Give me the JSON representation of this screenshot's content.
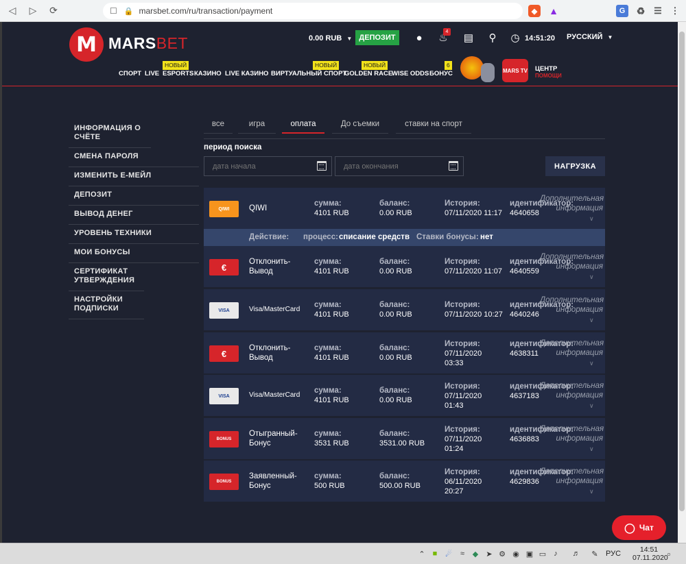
{
  "browser": {
    "url": "marsbet.com/ru/transaction/payment"
  },
  "header": {
    "logo_letter": "M",
    "logo_mars": "MARS",
    "logo_bet": "BET",
    "balance": "0.00 RUB",
    "deposit_label": "ДЕПОЗИТ",
    "notification_count": "4",
    "time": "14:51:20",
    "language": "РУССКИЙ",
    "menu": [
      {
        "label": "СПОРТ"
      },
      {
        "label": "LIVE"
      },
      {
        "label": "ESPORTS",
        "badge": "НОВЫЙ"
      },
      {
        "label": "КАЗИНО"
      },
      {
        "label": "LIVE КАЗИНО"
      },
      {
        "label": "ВИРТУАЛЬНЫЙ СПОРТ",
        "badge": "НОВЫЙ"
      },
      {
        "label": "GOLDEN RACE",
        "badge": "НОВЫЙ"
      },
      {
        "label": "WISE ODDS"
      },
      {
        "label": "БОНУС",
        "badge": "6"
      }
    ],
    "promo_mars_tv": "MARS TV",
    "help_center_line1": "ЦЕНТР",
    "help_center_line2": "ПОМОЩИ"
  },
  "sidebar": {
    "items": [
      "ИНФОРМАЦИЯ О СЧЁТЕ",
      "СМЕНА ПАРОЛЯ",
      "ИЗМЕНИТЬ Е-МЕЙЛ",
      "ДЕПОЗИТ",
      "ВЫВОД ДЕНЕГ",
      "УРОВЕНЬ ТЕХНИКИ",
      "МОИ БОНУСЫ",
      "СЕРТИФИКАТ УТВЕРЖДЕНИЯ",
      "НАСТРОЙКИ ПОДПИСКИ"
    ]
  },
  "tabs": [
    {
      "label": "все",
      "active": false
    },
    {
      "label": "игра",
      "active": false
    },
    {
      "label": "оплата",
      "active": true
    },
    {
      "label": "До съемки",
      "active": false
    },
    {
      "label": "ставки на спорт",
      "active": false
    }
  ],
  "filters": {
    "period_label": "период поиска",
    "start_placeholder": "дата начала",
    "end_placeholder": "дата окончания",
    "load_label": "НАГРУЗКА"
  },
  "labels": {
    "amount": "сумма:",
    "balance": "баланс:",
    "history": "История:",
    "id": "идентификатор:",
    "more_line1": "Дополнительная",
    "more_line2": "информация"
  },
  "detail": {
    "action_label": "Действие:",
    "process_label": "процесс:",
    "process_value": "списание средств",
    "bonus_label": "Ставки бонусы:",
    "bonus_value": "нет"
  },
  "transactions": [
    {
      "logo": "qiwi",
      "logo_text": "QIWI",
      "name1": "QIWI",
      "name2": "",
      "amount": "4101 RUB",
      "balance": "0.00 RUB",
      "date1": "07/11/2020 11:17",
      "date2": "",
      "id": "4640658"
    },
    {
      "logo": "euro",
      "logo_text": "€",
      "name1": "Отклонить-",
      "name2": "Вывод",
      "amount": "4101 RUB",
      "balance": "0.00 RUB",
      "date1": "07/11/2020 11:07",
      "date2": "",
      "id": "4640559"
    },
    {
      "logo": "visa",
      "logo_text": "VISA",
      "name1": "Visa/MasterCard",
      "name2": "",
      "amount": "4101 RUB",
      "balance": "0.00 RUB",
      "date1": "07/11/2020 10:27",
      "date2": "",
      "id": "4640246"
    },
    {
      "logo": "euro",
      "logo_text": "€",
      "name1": "Отклонить-",
      "name2": "Вывод",
      "amount": "4101 RUB",
      "balance": "0.00 RUB",
      "date1": "07/11/2020",
      "date2": "03:33",
      "id": "4638311"
    },
    {
      "logo": "visa",
      "logo_text": "VISA",
      "name1": "Visa/MasterCard",
      "name2": "",
      "amount": "4101 RUB",
      "balance": "0.00 RUB",
      "date1": "07/11/2020",
      "date2": "01:43",
      "id": "4637183"
    },
    {
      "logo": "bonus",
      "logo_text": "BONUS",
      "name1": "Отыгранный-",
      "name2": "Бонус",
      "amount": "3531 RUB",
      "balance": "3531.00 RUB",
      "date1": "07/11/2020",
      "date2": "01:24",
      "id": "4636883"
    },
    {
      "logo": "bonus",
      "logo_text": "BONUS",
      "name1": "Заявленный-",
      "name2": "Бонус",
      "amount": "500 RUB",
      "balance": "500.00 RUB",
      "date1": "06/11/2020",
      "date2": "20:27",
      "id": "4629836"
    }
  ],
  "chat_label": "Чат",
  "taskbar": {
    "language": "РУС",
    "time": "14:51",
    "date": "07.11.2020"
  },
  "colors": {
    "accent_red": "#d6252a",
    "deposit_green": "#26a244",
    "row_bg": "#232b44",
    "page_bg": "#1e2230"
  }
}
